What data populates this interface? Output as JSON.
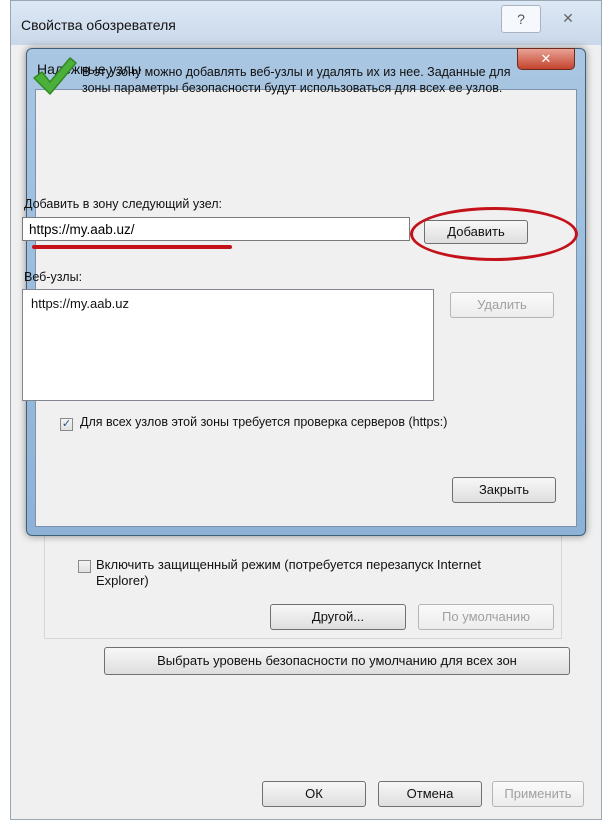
{
  "outer_dialog": {
    "title": "Свойства обозревателя",
    "help_button": "?",
    "close_button": "✕",
    "protected_mode_label": "Включить защищенный режим (потребуется перезапуск Internet Explorer)",
    "protected_mode_checked": false,
    "other_button": "Другой...",
    "default_button": "По умолчанию",
    "reset_all_button": "Выбрать уровень безопасности по умолчанию для всех зон",
    "ok_button": "ОК",
    "cancel_button": "Отмена",
    "apply_button": "Применить"
  },
  "trusted_dialog": {
    "title": "Надежные узлы",
    "close_button": "✕",
    "info_text": "В эту зону можно добавлять веб-узлы и удалять их из нее. Заданные для зоны параметры безопасности будут использоваться для всех ее узлов.",
    "add_label": "Добавить в зону следующий узел:",
    "url_input_value": "https://my.aab.uz/",
    "add_button": "Добавить",
    "sites_label": "Веб-узлы:",
    "sites": [
      "https://my.aab.uz"
    ],
    "remove_button": "Удалить",
    "https_checkbox_label": "Для всех узлов этой зоны требуется проверка серверов (https:)",
    "https_checkbox_checked": true,
    "close_dialog_button": "Закрыть"
  },
  "colors": {
    "annotation_red": "#c4121a",
    "check_green": "#4caf3a"
  },
  "icons": {
    "info": "check-mark-icon"
  }
}
